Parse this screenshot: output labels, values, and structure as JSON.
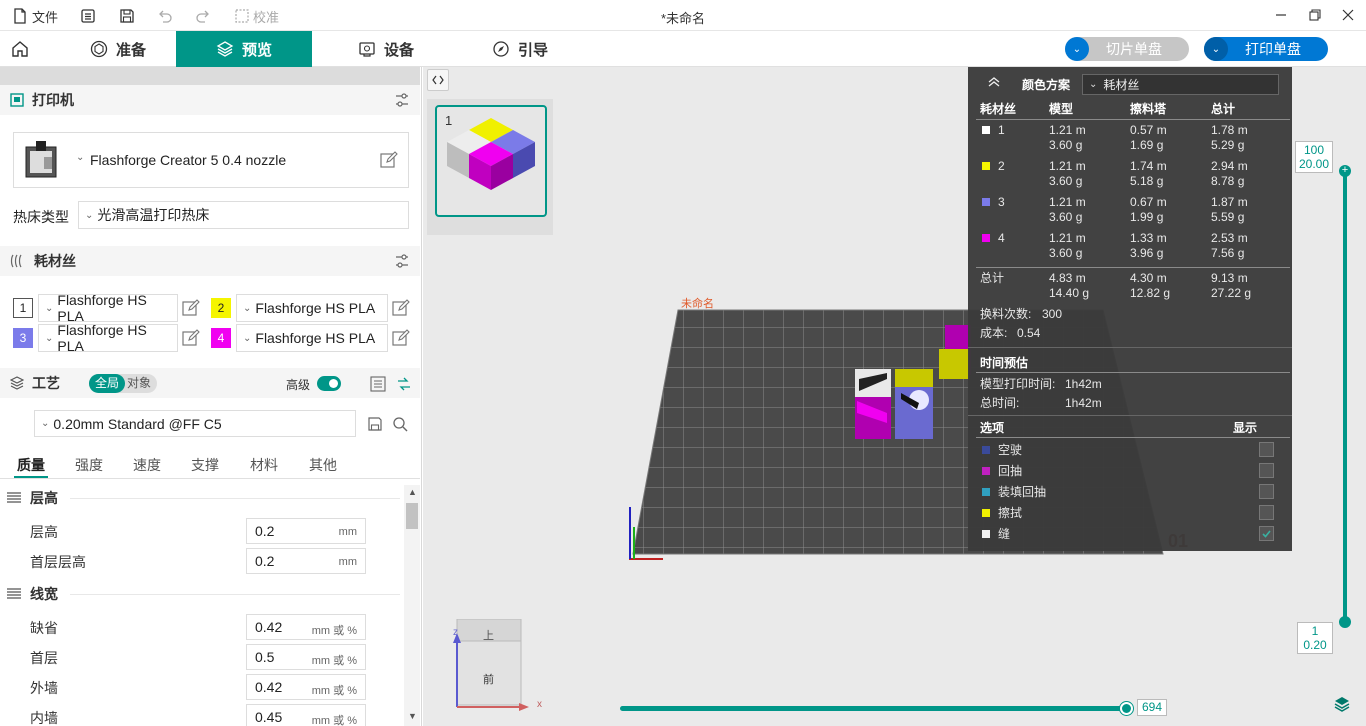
{
  "titlebar": {
    "file_label": "文件",
    "calibrate_label": "校准",
    "window_title": "*未命名"
  },
  "tabs": [
    {
      "label": "准备"
    },
    {
      "label": "预览"
    },
    {
      "label": "设备"
    },
    {
      "label": "引导"
    }
  ],
  "actions": {
    "slice_label": "切片单盘",
    "print_label": "打印单盘"
  },
  "printer": {
    "section_title": "打印机",
    "preset": "Flashforge Creator 5 0.4 nozzle",
    "bed_type_label": "热床类型",
    "bed_type": "光滑高温打印热床"
  },
  "filament": {
    "section_title": "耗材丝",
    "slots": [
      {
        "num": "1",
        "name": "Flashforge HS PLA",
        "color": "#ffffff"
      },
      {
        "num": "2",
        "name": "Flashforge HS PLA",
        "color": "#f5f500"
      },
      {
        "num": "3",
        "name": "Flashforge HS PLA",
        "color": "#7b7bea"
      },
      {
        "num": "4",
        "name": "Flashforge HS PLA",
        "color": "#f000f0"
      }
    ]
  },
  "process": {
    "section_title": "工艺",
    "toggle_global": "全局",
    "toggle_object": "对象",
    "advanced_label": "高级",
    "preset": "0.20mm Standard @FF C5",
    "subtabs": [
      "质量",
      "强度",
      "速度",
      "支撑",
      "材料",
      "其他"
    ],
    "groups": {
      "layer_height": {
        "title": "层高",
        "rows": [
          {
            "label": "层高",
            "value": "0.2",
            "unit": "mm"
          },
          {
            "label": "首层层高",
            "value": "0.2",
            "unit": "mm"
          }
        ]
      },
      "line_width": {
        "title": "线宽",
        "rows": [
          {
            "label": "缺省",
            "value": "0.42",
            "unit": "mm 或 %"
          },
          {
            "label": "首层",
            "value": "0.5",
            "unit": "mm 或 %"
          },
          {
            "label": "外墙",
            "value": "0.42",
            "unit": "mm 或 %"
          },
          {
            "label": "内墙",
            "value": "0.45",
            "unit": "mm 或 %"
          }
        ]
      }
    }
  },
  "plate": {
    "number": "1"
  },
  "viewport": {
    "plate_name": "未命名",
    "plate_id": "01",
    "axis_z": "z",
    "axis_x": "x",
    "cube_top": "上",
    "cube_front": "前"
  },
  "color_scheme": {
    "label": "颜色方案",
    "value": "耗材丝",
    "headers": {
      "filament": "耗材丝",
      "model": "模型",
      "tower": "擦料塔",
      "total": "总计"
    },
    "rows": [
      {
        "id": "1",
        "color": "#ffffff",
        "model_m": "1.21 m",
        "model_g": "3.60 g",
        "tower_m": "0.57 m",
        "tower_g": "1.69 g",
        "total_m": "1.78 m",
        "total_g": "5.29 g"
      },
      {
        "id": "2",
        "color": "#f5f500",
        "model_m": "1.21 m",
        "model_g": "3.60 g",
        "tower_m": "1.74 m",
        "tower_g": "5.18 g",
        "total_m": "2.94 m",
        "total_g": "8.78 g"
      },
      {
        "id": "3",
        "color": "#7b7bea",
        "model_m": "1.21 m",
        "model_g": "3.60 g",
        "tower_m": "0.67 m",
        "tower_g": "1.99 g",
        "total_m": "1.87 m",
        "total_g": "5.59 g"
      },
      {
        "id": "4",
        "color": "#f000f0",
        "model_m": "1.21 m",
        "model_g": "3.60 g",
        "tower_m": "1.33 m",
        "tower_g": "3.96 g",
        "total_m": "2.53 m",
        "total_g": "7.56 g"
      }
    ],
    "sum": {
      "label": "总计",
      "model_m": "4.83 m",
      "model_g": "14.40 g",
      "tower_m": "4.30 m",
      "tower_g": "12.82 g",
      "total_m": "9.13 m",
      "total_g": "27.22 g"
    },
    "changes_label": "换料次数:",
    "changes_value": "300",
    "cost_label": "成本:",
    "cost_value": "0.54",
    "time_title": "时间预估",
    "model_time_label": "模型打印时间:",
    "model_time_value": "1h42m",
    "total_time_label": "总时间:",
    "total_time_value": "1h42m",
    "options_title": "选项",
    "display_title": "显示",
    "options": [
      {
        "label": "空驶",
        "color": "#3a4a9a",
        "checked": false
      },
      {
        "label": "回抽",
        "color": "#c020c0",
        "checked": false
      },
      {
        "label": "装填回抽",
        "color": "#30a0c0",
        "checked": false
      },
      {
        "label": "擦拭",
        "color": "#f0f000",
        "checked": false
      },
      {
        "label": "缝",
        "color": "#f0f0f0",
        "checked": true
      }
    ]
  },
  "layer_slider": {
    "top_layer": "100",
    "top_height": "20.00",
    "bottom_layer": "1",
    "bottom_height": "0.20"
  },
  "move_slider": {
    "value": "694"
  }
}
